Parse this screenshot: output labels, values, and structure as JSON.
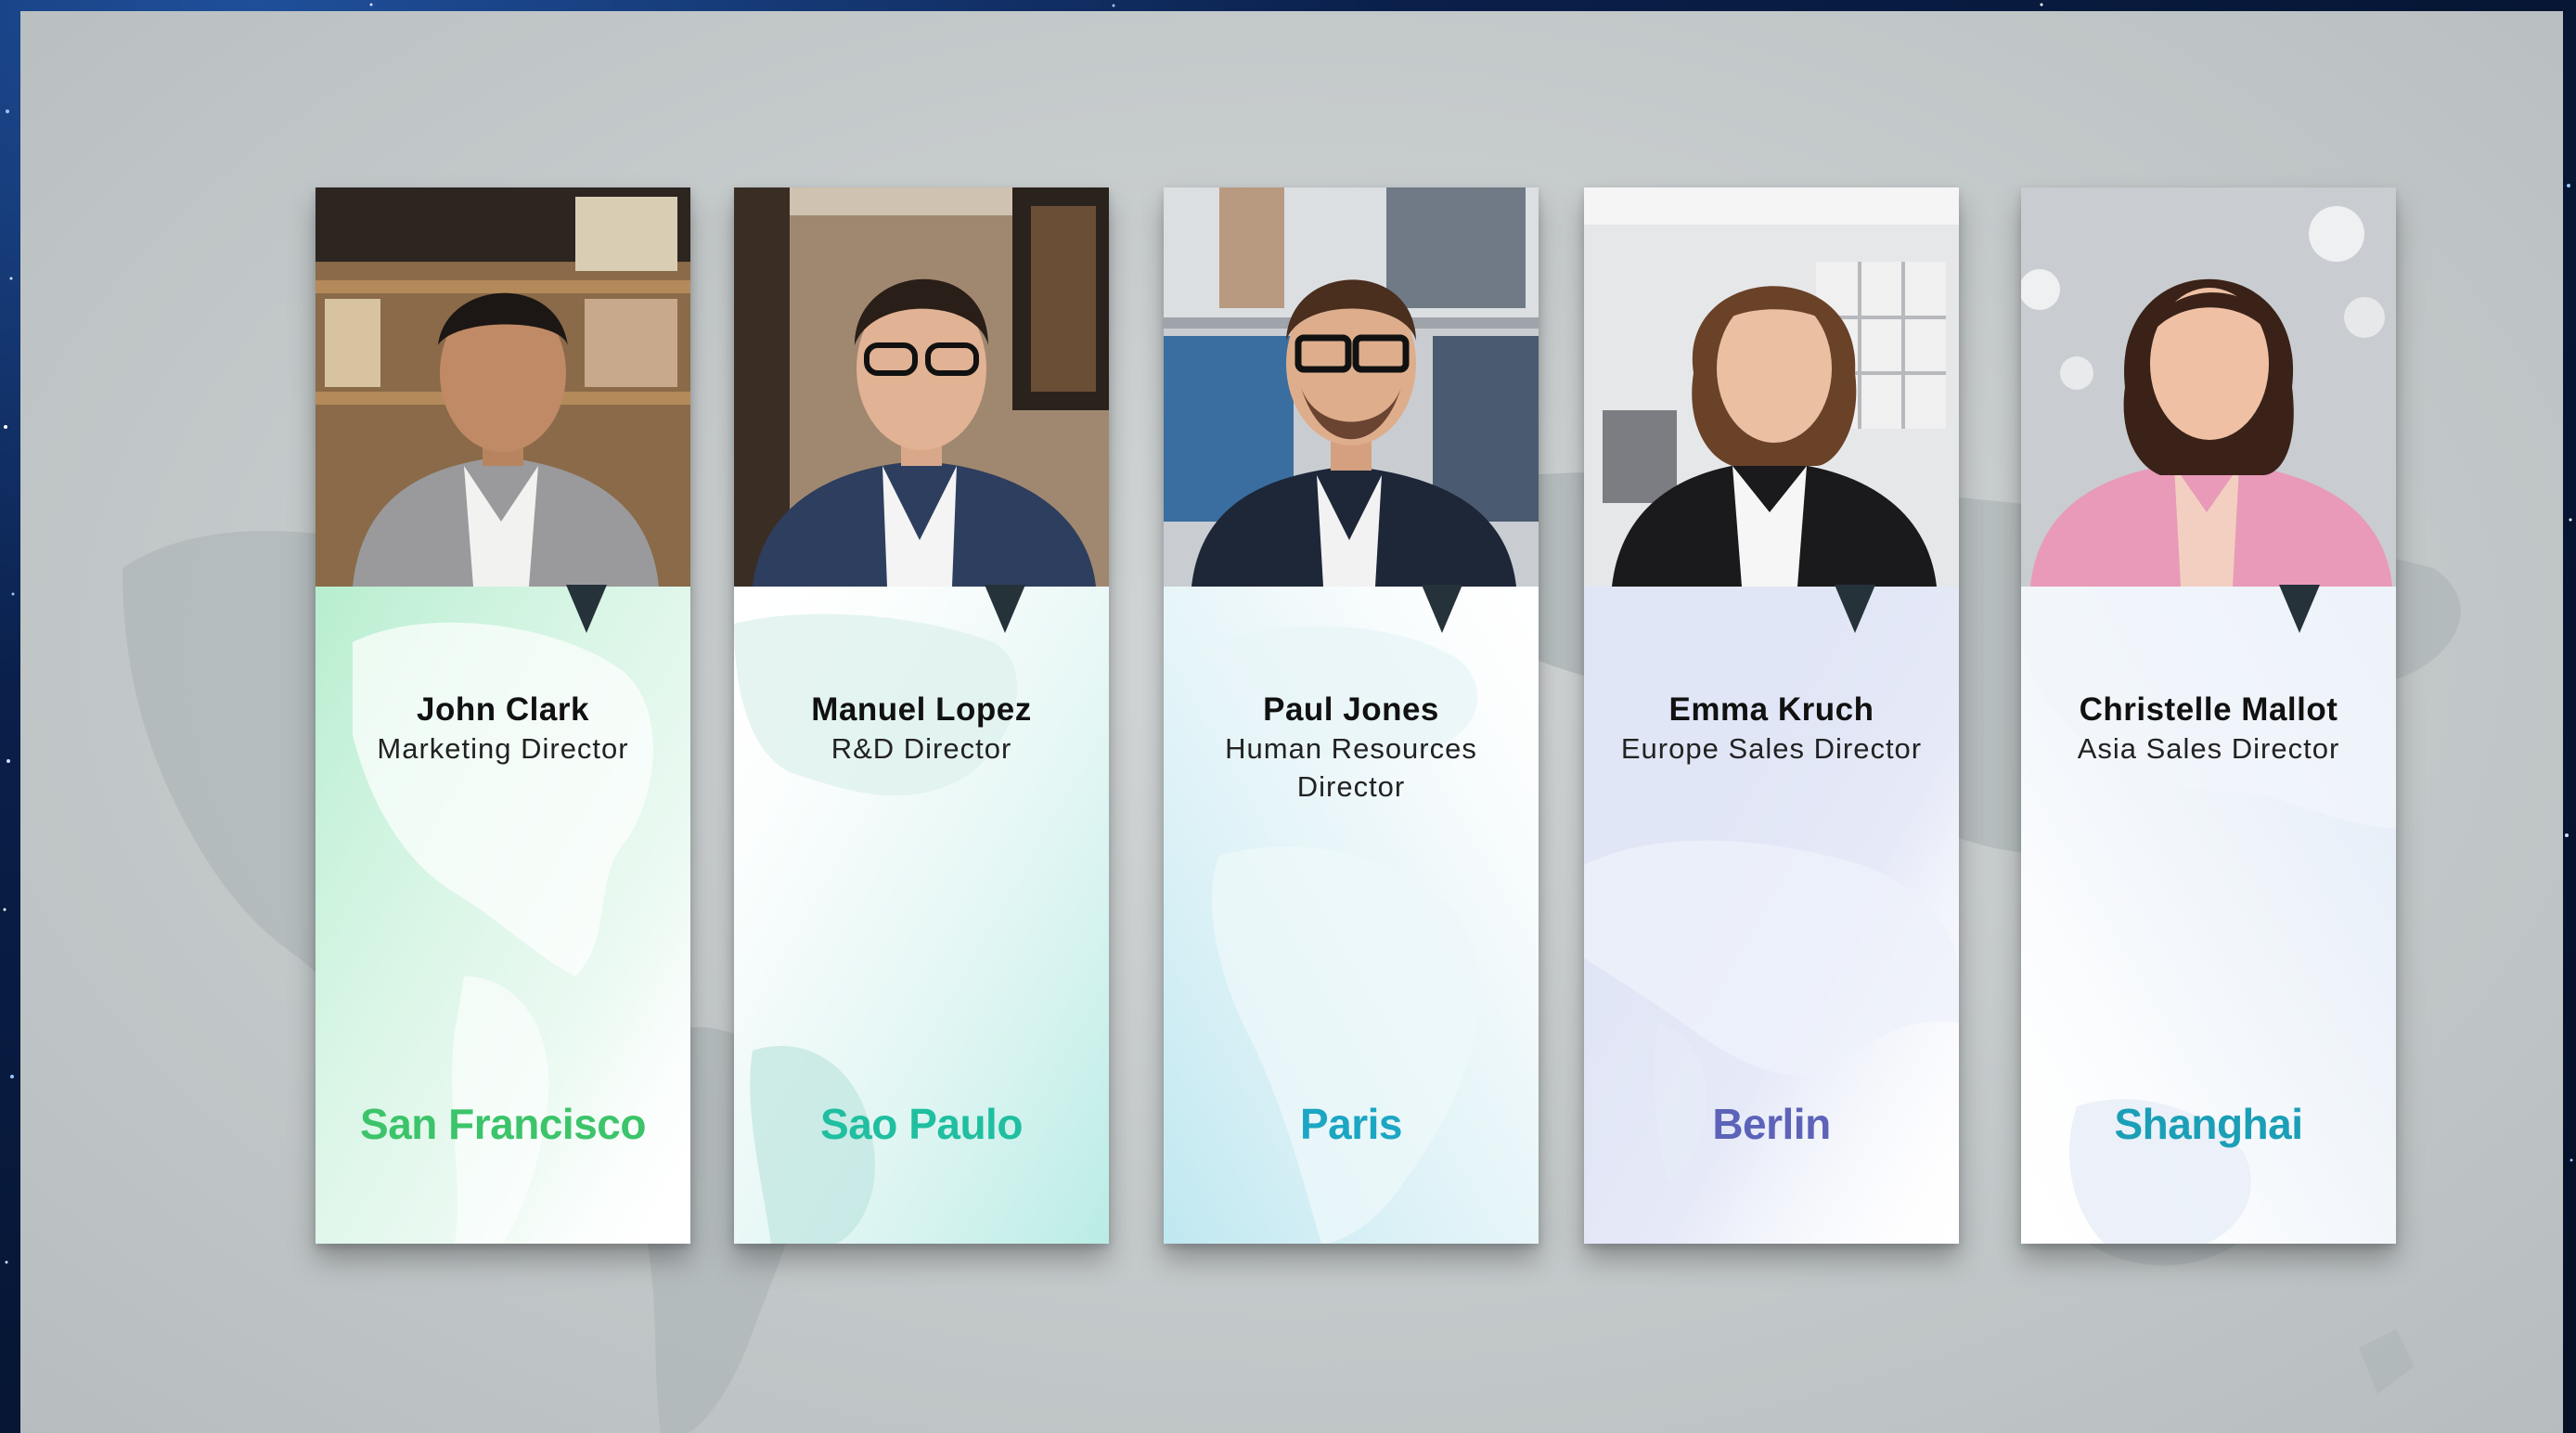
{
  "cards": [
    {
      "name": "John Clark",
      "role": "Marketing Director",
      "city": "San Francisco",
      "city_color": "#3cc46a",
      "tint": "#7de0a8"
    },
    {
      "name": "Manuel Lopez",
      "role": "R&D Director",
      "city": "Sao Paulo",
      "city_color": "#1fbfa0",
      "tint": "#80dcd0"
    },
    {
      "name": "Paul Jones",
      "role": "Human Resources Director",
      "city": "Paris",
      "city_color": "#1ca6c4",
      "tint": "#7fd0e2"
    },
    {
      "name": "Emma Kruch",
      "role": "Europe Sales Director",
      "city": "Berlin",
      "city_color": "#5d63b8",
      "tint": "#a9b6e6"
    },
    {
      "name": "Christelle Mallot",
      "role": "Asia Sales Director",
      "city": "Shanghai",
      "city_color": "#1a9fb6",
      "tint": "#a9c6e9"
    }
  ]
}
